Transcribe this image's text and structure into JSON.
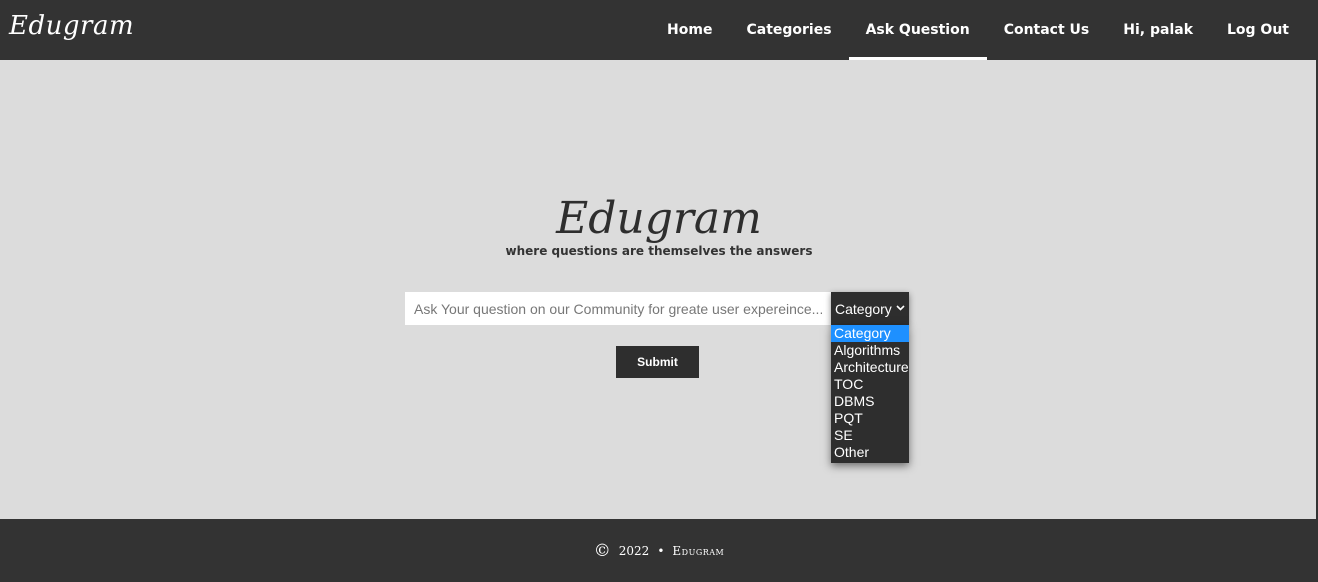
{
  "navbar": {
    "brand": "Edugram",
    "links": [
      {
        "label": "Home"
      },
      {
        "label": "Categories"
      },
      {
        "label": "Ask Question",
        "active": true
      },
      {
        "label": "Contact Us"
      },
      {
        "label": "Hi, palak"
      },
      {
        "label": "Log Out"
      }
    ]
  },
  "hero": {
    "title": "Edugram",
    "tagline": "where questions are themselves the answers"
  },
  "form": {
    "question_placeholder": "Ask Your question on our Community for greate user expereince...",
    "category_selected": "Category",
    "category_options": [
      "Category",
      "Algorithms",
      "Architecture",
      "TOC",
      "DBMS",
      "PQT",
      "SE",
      "Other"
    ],
    "submit_label": "Submit"
  },
  "footer": {
    "copyright_symbol": "©",
    "year": "2022",
    "separator": "•",
    "brand": "Edugram"
  },
  "colors": {
    "navbar_bg": "#333333",
    "page_bg": "#dcdcdc",
    "selected_option": "#1e90ff"
  }
}
